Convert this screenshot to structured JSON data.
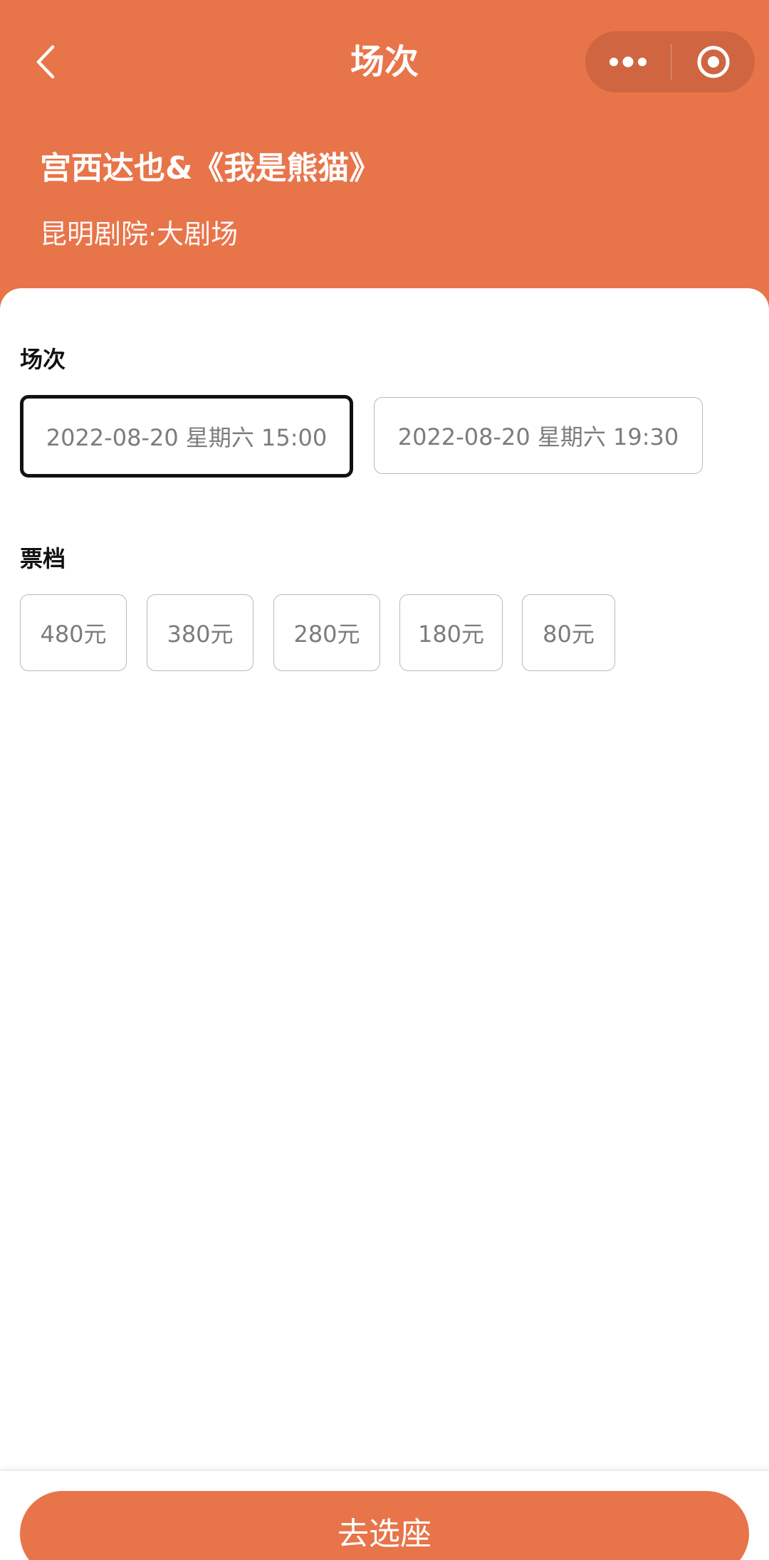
{
  "nav": {
    "title": "场次",
    "back_icon": "chevron-left-icon",
    "more_icon": "more-dots-icon",
    "close_icon": "target-circle-icon"
  },
  "show": {
    "title": "宫西达也&《我是熊猫》",
    "venue": "昆明剧院·大剧场"
  },
  "sessions": {
    "label": "场次",
    "options": [
      {
        "text": "2022-08-20  星期六 15:00",
        "selected": true
      },
      {
        "text": "2022-08-20  星期六 19:30",
        "selected": false
      }
    ]
  },
  "prices": {
    "label": "票档",
    "options": [
      "480元",
      "380元",
      "280元",
      "180元",
      "80元"
    ]
  },
  "action": {
    "label": "去选座"
  },
  "colors": {
    "accent": "#e8744a",
    "capsule": "#cf6641",
    "selected_border": "#111111",
    "option_text": "#7c7c7c"
  }
}
